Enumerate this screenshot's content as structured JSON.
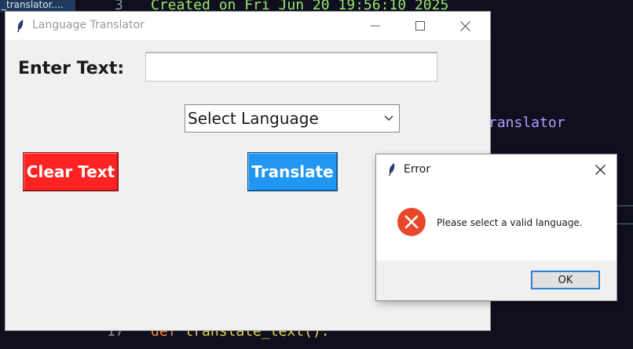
{
  "editor": {
    "tab_label": "_translator....",
    "line_3_num": "3",
    "line_3_code": "Created on Fri Jun 20 19:56:10 2025",
    "mid_code": "ranslator",
    "line_17_num": "17",
    "line_17_keyword": "def",
    "line_17_code": " translate_text():"
  },
  "window": {
    "title": "Language Translator",
    "minimize": "—",
    "maximize": "☐",
    "close": "✕",
    "enter_text_label": "Enter Text:",
    "text_value": "",
    "language_select_value": "Select Language",
    "clear_button_label": "Clear Text",
    "translate_button_label": "Translate"
  },
  "dialog": {
    "title": "Error",
    "message": "Please select a valid language.",
    "ok_label": "OK"
  },
  "colors": {
    "clear_button": "#ff2323",
    "translate_button": "#2196f3",
    "error_icon": "#e8472b"
  }
}
